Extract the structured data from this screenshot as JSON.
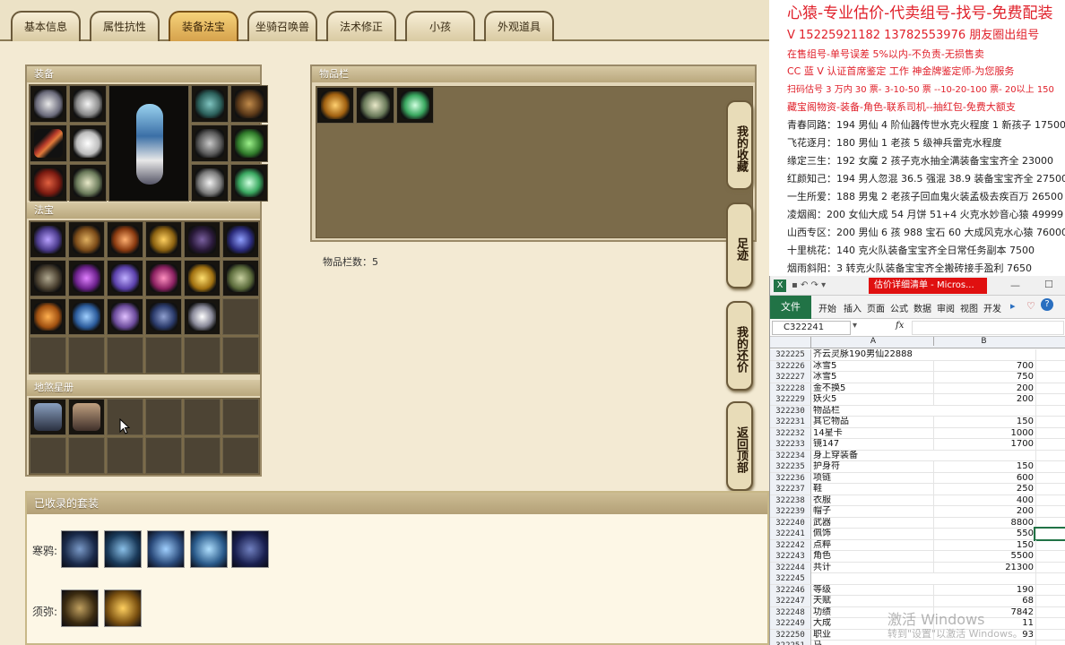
{
  "tabs": [
    "基本信息",
    "属性抗性",
    "装备法宝",
    "坐骑召唤兽",
    "法术修正",
    "小孩",
    "外观道具"
  ],
  "active_tab": 2,
  "panels": {
    "equipment": "装备",
    "fabao": "法宝",
    "disha": "地煞星册",
    "inventory": "物品栏",
    "inventory_count": "物品栏数：5",
    "collected_sets": "已收录的套装"
  },
  "side_buttons": [
    "我的收藏",
    "足迹",
    "我的还价",
    "返回顶部"
  ],
  "sets": [
    {
      "label": "寒鸦:"
    },
    {
      "label": "须弥:"
    }
  ],
  "ad_lines": [
    {
      "text": "心猿-专业估价-代卖组号-找号-免费配装",
      "color": "#e0202a"
    },
    {
      "text": "V 15225921182   13782553976 朋友圈出组号",
      "color": "#e0202a"
    },
    {
      "text": "在售组号-单号误差 5%以内-不负责-无损售卖",
      "color": "#e0202a"
    },
    {
      "text": "CC 蓝 V 认证首席鉴定 工作 神金牌鉴定师-为您服务",
      "color": "#e0202a"
    },
    {
      "text": "扫码估号 3 万内 30 票- 3-10-50 票  --10-20-100 票- 20以上 150",
      "color": "#e0202a"
    },
    {
      "text": "藏宝阁物资-装备-角色-联系司机--抽红包-免费大额支",
      "color": "#e0202a"
    },
    {
      "text": "青春同路：194 男仙 4 阶仙器传世水克火程度 1 新孩子 17500",
      "color": "#222"
    },
    {
      "text": "飞花逐月：180 男仙 1 老孩 5 级神兵雷克水程度",
      "color": "#222"
    },
    {
      "text": "缘定三生：192 女魔 2 孩子克水抽全满装备宝宝齐全 23000",
      "color": "#222"
    },
    {
      "text": "红颜知己：194 男人忽混 36.5 强混 38.9 装备宝宝齐全 27500",
      "color": "#222"
    },
    {
      "text": "一生所爱：188 男鬼 2 老孩子回血鬼火装孟极去疾百万 26500",
      "color": "#222"
    },
    {
      "text": "凌烟阁：200 女仙大成 54 月饼 51+4 火克水妙音心猿 49999",
      "color": "#222"
    },
    {
      "text": "山西专区：200 男仙 6 孩 988 宝石 60 大成风克水心猿 76000",
      "color": "#222"
    },
    {
      "text": "十里桃花：140 克火队装备宝宝齐全日常任务副本 7500",
      "color": "#222"
    },
    {
      "text": "烟雨斜阳：3 转克火队装备宝宝齐全搬砖接手盈利 7650",
      "color": "#222"
    }
  ],
  "excel": {
    "title": "估价详细清单 - Micros...",
    "ribbon": [
      "文件",
      "开始",
      "插入",
      "页面",
      "公式",
      "数据",
      "审阅",
      "视图",
      "开发"
    ],
    "namebox": "C322241",
    "fx": "fx",
    "columns": [
      "A",
      "B"
    ],
    "rows": [
      {
        "n": "322225",
        "a": "齐云灵脉190男仙22888",
        "b": ""
      },
      {
        "n": "322226",
        "a": "冰雪5",
        "b": "700"
      },
      {
        "n": "322227",
        "a": "冰雪5",
        "b": "750"
      },
      {
        "n": "322228",
        "a": "金不换5",
        "b": "200"
      },
      {
        "n": "322229",
        "a": "妖火5",
        "b": "200"
      },
      {
        "n": "322230",
        "a": "物品栏",
        "b": ""
      },
      {
        "n": "322231",
        "a": "其它物品",
        "b": "150"
      },
      {
        "n": "322232",
        "a": "14星卡",
        "b": "1000"
      },
      {
        "n": "322233",
        "a": "镜147",
        "b": "1700"
      },
      {
        "n": "322234",
        "a": "身上穿装备",
        "b": ""
      },
      {
        "n": "322235",
        "a": "护身符",
        "b": "150"
      },
      {
        "n": "322236",
        "a": "项链",
        "b": "600"
      },
      {
        "n": "322237",
        "a": "鞋",
        "b": "250"
      },
      {
        "n": "322238",
        "a": "衣服",
        "b": "400"
      },
      {
        "n": "322239",
        "a": "帽子",
        "b": "200"
      },
      {
        "n": "322240",
        "a": "武器",
        "b": "8800"
      },
      {
        "n": "322241",
        "a": "佩饰",
        "b": "550"
      },
      {
        "n": "322242",
        "a": "点粹",
        "b": "150"
      },
      {
        "n": "322243",
        "a": "角色",
        "b": "5500"
      },
      {
        "n": "322244",
        "a": "共计",
        "b": "21300"
      },
      {
        "n": "322245",
        "a": "",
        "b": ""
      },
      {
        "n": "322246",
        "a": "等级",
        "b": "190"
      },
      {
        "n": "322247",
        "a": "天赋",
        "b": "68"
      },
      {
        "n": "322248",
        "a": "功绩",
        "b": "7842"
      },
      {
        "n": "322249",
        "a": "大成",
        "b": "11"
      },
      {
        "n": "322250",
        "a": "职业",
        "b": "93"
      },
      {
        "n": "322251",
        "a": "马",
        "b": ""
      }
    ]
  },
  "watermark": {
    "title": "激活 Windows",
    "sub": "转到\"设置\"以激活 Windows。"
  },
  "colors": {
    "active_tab": "#d6a24c",
    "ad_red": "#e0202a",
    "excel_green": "#217346",
    "excel_title_red": "#e01010"
  }
}
